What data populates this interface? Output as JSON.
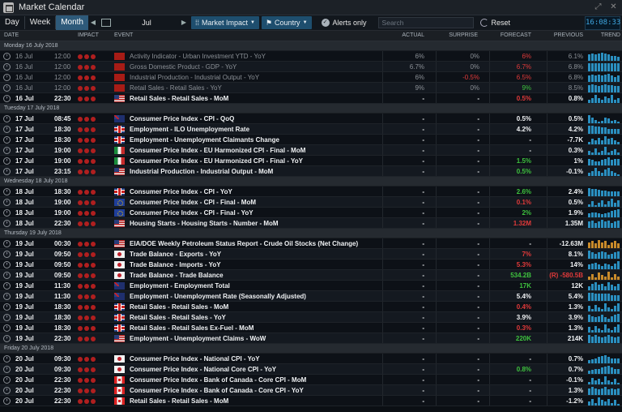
{
  "window": {
    "title": "Market Calendar"
  },
  "toolbar": {
    "day": "Day",
    "week": "Week",
    "month": "Month",
    "month_value": "Jul",
    "market_impact": "Market Impact",
    "country": "Country",
    "alerts_only": "Alerts only",
    "search_placeholder": "Search",
    "reset": "Reset",
    "clock": "16:08:33"
  },
  "columns": {
    "date": "DATE",
    "impact": "IMPACT",
    "event": "EVENT",
    "actual": "ACTUAL",
    "surprise": "SURPRISE",
    "forecast": "FORECAST",
    "previous": "PREVIOUS",
    "trend": "TREND"
  },
  "colors": {
    "accent": "#2e5a7a",
    "impact_dot": "#b01f1f",
    "negative": "#e23a3a",
    "positive": "#3ec23e",
    "trend_bar": "#2a8fc0",
    "trend_bar_alt": "#c88a2a"
  },
  "days": [
    {
      "label": "Monday 16 July 2018",
      "rows": [
        {
          "date": "16 Jul",
          "time": "12:00",
          "flag": "cn",
          "event": "Activity Indicator - Urban Investment YTD - YoY",
          "actual": "6%",
          "surprise": "0%",
          "forecast": "6%",
          "forecast_color": "red",
          "previous": "6.1%",
          "state": "past",
          "trend": [
            6,
            7,
            6,
            7,
            8,
            7,
            6,
            5,
            5,
            4
          ],
          "trend_color": "blue"
        },
        {
          "date": "16 Jul",
          "time": "12:00",
          "flag": "cn",
          "event": "Gross Domestic Product - GDP - YoY",
          "actual": "6.7%",
          "surprise": "0%",
          "forecast": "6.7%",
          "forecast_color": "red",
          "previous": "6.8%",
          "state": "past",
          "trend": [
            7,
            7,
            7,
            7,
            7,
            7,
            7,
            7,
            7,
            7
          ],
          "trend_color": "blue"
        },
        {
          "date": "16 Jul",
          "time": "12:00",
          "flag": "cn",
          "event": "Industrial Production - Industrial Output - YoY",
          "actual": "6%",
          "surprise": "-0.5%",
          "surprise_color": "red",
          "forecast": "6.5%",
          "forecast_color": "red",
          "previous": "6.8%",
          "state": "past",
          "trend": [
            6,
            7,
            6,
            7,
            6,
            7,
            8,
            6,
            5,
            6
          ],
          "trend_color": "blue"
        },
        {
          "date": "16 Jul",
          "time": "12:00",
          "flag": "cn",
          "event": "Retail Sales - Retail Sales - YoY",
          "actual": "9%",
          "surprise": "0%",
          "forecast": "9%",
          "forecast_color": "green",
          "previous": "8.5%",
          "state": "past",
          "trend": [
            9,
            10,
            9,
            8,
            9,
            10,
            9,
            9,
            8,
            8
          ],
          "trend_color": "blue"
        },
        {
          "date": "16 Jul",
          "time": "22:30",
          "flag": "us",
          "event": "Retail Sales - Retail Sales - MoM",
          "actual": "-",
          "surprise": "-",
          "forecast": "0.5%",
          "forecast_color": "red",
          "previous": "0.8%",
          "state": "cur",
          "trend": [
            2,
            3,
            5,
            3,
            2,
            4,
            3,
            5,
            2,
            3
          ],
          "trend_color": "blue"
        }
      ]
    },
    {
      "label": "Tuesday 17 July 2018",
      "rows": [
        {
          "date": "17 Jul",
          "time": "08:45",
          "flag": "au",
          "event": "Consumer Price Index - CPI - QoQ",
          "actual": "-",
          "surprise": "-",
          "forecast": "0.5%",
          "forecast_color": "white",
          "previous": "0.5%",
          "state": "cur",
          "trend": [
            9,
            6,
            4,
            2,
            3,
            6,
            5,
            3,
            4,
            2
          ],
          "trend_color": "blue"
        },
        {
          "date": "17 Jul",
          "time": "18:30",
          "flag": "gb",
          "event": "Employment - ILO Unemployment Rate",
          "actual": "-",
          "surprise": "-",
          "forecast": "4.2%",
          "forecast_color": "white",
          "previous": "4.2%",
          "state": "cur",
          "trend": [
            8,
            8,
            7,
            7,
            6,
            6,
            5,
            5,
            5,
            5
          ],
          "trend_color": "blue"
        },
        {
          "date": "17 Jul",
          "time": "18:30",
          "flag": "gb",
          "event": "Employment - Unemployment Claimants Change",
          "actual": "-",
          "surprise": "-",
          "forecast": "-",
          "forecast_color": "white",
          "previous": "-7.7K",
          "state": "cur",
          "trend": [
            2,
            4,
            3,
            5,
            3,
            6,
            4,
            5,
            3,
            2
          ],
          "trend_color": "blue"
        },
        {
          "date": "17 Jul",
          "time": "19:00",
          "flag": "it",
          "event": "Consumer Price Index - EU Harmonized CPI - Final - MoM",
          "actual": "-",
          "surprise": "-",
          "forecast": "-",
          "forecast_color": "white",
          "previous": "0.3%",
          "state": "cur",
          "trend": [
            3,
            2,
            5,
            2,
            3,
            6,
            2,
            3,
            4,
            2
          ],
          "trend_color": "blue"
        },
        {
          "date": "17 Jul",
          "time": "19:00",
          "flag": "it",
          "event": "Consumer Price Index - EU Harmonized CPI - Final - YoY",
          "actual": "-",
          "surprise": "-",
          "forecast": "1.5%",
          "forecast_color": "green",
          "previous": "1%",
          "state": "cur",
          "trend": [
            5,
            4,
            3,
            3,
            4,
            5,
            6,
            4,
            5,
            5
          ],
          "trend_color": "blue"
        },
        {
          "date": "17 Jul",
          "time": "23:15",
          "flag": "us",
          "event": "Industrial Production - Industrial Output - MoM",
          "actual": "-",
          "surprise": "-",
          "forecast": "0.5%",
          "forecast_color": "green",
          "previous": "-0.1%",
          "state": "cur",
          "trend": [
            2,
            3,
            5,
            3,
            2,
            4,
            5,
            3,
            2,
            1
          ],
          "trend_color": "blue"
        }
      ]
    },
    {
      "label": "Wednesday 18 July 2018",
      "rows": [
        {
          "date": "18 Jul",
          "time": "18:30",
          "flag": "gb",
          "event": "Consumer Price Index - CPI - YoY",
          "actual": "-",
          "surprise": "-",
          "forecast": "2.6%",
          "forecast_color": "green",
          "previous": "2.4%",
          "state": "cur",
          "trend": [
            9,
            8,
            8,
            7,
            6,
            6,
            5,
            5,
            5,
            5
          ],
          "trend_color": "blue"
        },
        {
          "date": "18 Jul",
          "time": "19:00",
          "flag": "eu",
          "event": "Consumer Price Index - CPI - Final - MoM",
          "actual": "-",
          "surprise": "-",
          "forecast": "0.1%",
          "forecast_color": "red",
          "previous": "0.5%",
          "state": "cur",
          "trend": [
            2,
            4,
            1,
            3,
            5,
            2,
            4,
            6,
            3,
            5
          ],
          "trend_color": "blue"
        },
        {
          "date": "18 Jul",
          "time": "19:00",
          "flag": "eu",
          "event": "Consumer Price Index - CPI - Final - YoY",
          "actual": "-",
          "surprise": "-",
          "forecast": "2%",
          "forecast_color": "green",
          "previous": "1.9%",
          "state": "cur",
          "trend": [
            4,
            5,
            5,
            4,
            3,
            4,
            5,
            6,
            7,
            8
          ],
          "trend_color": "blue"
        },
        {
          "date": "18 Jul",
          "time": "22:30",
          "flag": "us",
          "event": "Housing Starts - Housing Starts - Number - MoM",
          "actual": "-",
          "surprise": "-",
          "forecast": "1.32M",
          "forecast_color": "red",
          "previous": "1.35M",
          "state": "cur",
          "trend": [
            6,
            7,
            5,
            6,
            8,
            6,
            7,
            5,
            6,
            7
          ],
          "trend_color": "blue"
        }
      ]
    },
    {
      "label": "Thursday 19 July 2018",
      "rows": [
        {
          "date": "19 Jul",
          "time": "00:30",
          "flag": "us",
          "event": "EIA/DOE Weekly Petroleum Status Report - Crude Oil Stocks (Net Change)",
          "actual": "-",
          "surprise": "-",
          "forecast": "-",
          "forecast_color": "white",
          "previous": "-12.63M",
          "state": "cur",
          "trend": [
            5,
            6,
            4,
            7,
            5,
            6,
            3,
            5,
            6,
            4
          ],
          "trend_color": "orange"
        },
        {
          "date": "19 Jul",
          "time": "09:50",
          "flag": "jp",
          "event": "Trade Balance - Exports - YoY",
          "actual": "-",
          "surprise": "-",
          "forecast": "7%",
          "forecast_color": "red",
          "previous": "8.1%",
          "state": "cur",
          "trend": [
            8,
            6,
            5,
            6,
            7,
            6,
            4,
            5,
            6,
            7
          ],
          "trend_color": "blue"
        },
        {
          "date": "19 Jul",
          "time": "09:50",
          "flag": "jp",
          "event": "Trade Balance - Imports - YoY",
          "actual": "-",
          "surprise": "-",
          "forecast": "5.3%",
          "forecast_color": "red",
          "previous": "14%",
          "state": "cur",
          "trend": [
            5,
            6,
            7,
            5,
            4,
            6,
            5,
            4,
            6,
            9
          ],
          "trend_color": "blue"
        },
        {
          "date": "19 Jul",
          "time": "09:50",
          "flag": "jp",
          "event": "Trade Balance - Trade Balance",
          "actual": "-",
          "surprise": "-",
          "forecast": "534.2B",
          "forecast_color": "green",
          "previous": "(R) -580.5B",
          "previous_color": "red",
          "state": "cur",
          "trend": [
            3,
            5,
            2,
            6,
            4,
            3,
            7,
            2,
            5,
            3
          ],
          "trend_color": "orange"
        },
        {
          "date": "19 Jul",
          "time": "11:30",
          "flag": "au",
          "event": "Employment - Employment Total",
          "actual": "-",
          "surprise": "-",
          "forecast": "17K",
          "forecast_color": "green",
          "previous": "12K",
          "state": "cur",
          "trend": [
            3,
            5,
            6,
            4,
            5,
            3,
            6,
            4,
            3,
            5
          ],
          "trend_color": "blue"
        },
        {
          "date": "19 Jul",
          "time": "11:30",
          "flag": "au",
          "event": "Employment - Unemployment Rate (Seasonally Adjusted)",
          "actual": "-",
          "surprise": "-",
          "forecast": "5.4%",
          "forecast_color": "white",
          "previous": "5.4%",
          "state": "cur",
          "trend": [
            7,
            7,
            6,
            6,
            6,
            6,
            6,
            5,
            5,
            5
          ],
          "trend_color": "blue"
        },
        {
          "date": "19 Jul",
          "time": "18:30",
          "flag": "gb",
          "event": "Retail Sales - Retail Sales - MoM",
          "actual": "-",
          "surprise": "-",
          "forecast": "0.4%",
          "forecast_color": "red",
          "previous": "1.3%",
          "state": "cur",
          "trend": [
            4,
            2,
            5,
            3,
            2,
            6,
            3,
            2,
            4,
            6
          ],
          "trend_color": "blue"
        },
        {
          "date": "19 Jul",
          "time": "18:30",
          "flag": "gb",
          "event": "Retail Sales - Retail Sales - YoY",
          "actual": "-",
          "surprise": "-",
          "forecast": "3.9%",
          "forecast_color": "white",
          "previous": "3.9%",
          "state": "cur",
          "trend": [
            6,
            5,
            4,
            5,
            6,
            4,
            3,
            5,
            6,
            7
          ],
          "trend_color": "blue"
        },
        {
          "date": "19 Jul",
          "time": "18:30",
          "flag": "gb",
          "event": "Retail Sales - Retail Sales Ex-Fuel - MoM",
          "actual": "-",
          "surprise": "-",
          "forecast": "0.3%",
          "forecast_color": "red",
          "previous": "1.3%",
          "state": "cur",
          "trend": [
            4,
            2,
            5,
            3,
            2,
            6,
            3,
            2,
            4,
            6
          ],
          "trend_color": "blue"
        },
        {
          "date": "19 Jul",
          "time": "22:30",
          "flag": "us",
          "event": "Employment - Unemployment Claims - WoW",
          "actual": "-",
          "surprise": "-",
          "forecast": "220K",
          "forecast_color": "green",
          "previous": "214K",
          "state": "cur",
          "trend": [
            6,
            5,
            6,
            5,
            4,
            5,
            6,
            5,
            4,
            5
          ],
          "trend_color": "blue"
        }
      ]
    },
    {
      "label": "Friday 20 July 2018",
      "rows": [
        {
          "date": "20 Jul",
          "time": "09:30",
          "flag": "jp",
          "event": "Consumer Price Index - National CPI - YoY",
          "actual": "-",
          "surprise": "-",
          "forecast": "-",
          "forecast_color": "white",
          "previous": "0.7%",
          "state": "cur",
          "trend": [
            3,
            4,
            5,
            6,
            7,
            8,
            6,
            5,
            5,
            5
          ],
          "trend_color": "blue"
        },
        {
          "date": "20 Jul",
          "time": "09:30",
          "flag": "jp",
          "event": "Consumer Price Index - National Core CPI - YoY",
          "actual": "-",
          "surprise": "-",
          "forecast": "0.8%",
          "forecast_color": "green",
          "previous": "0.7%",
          "state": "cur",
          "trend": [
            3,
            4,
            5,
            5,
            6,
            7,
            8,
            6,
            5,
            5
          ],
          "trend_color": "blue"
        },
        {
          "date": "20 Jul",
          "time": "22:30",
          "flag": "ca",
          "event": "Consumer Price Index - Bank of Canada - Core CPI - MoM",
          "actual": "-",
          "surprise": "-",
          "forecast": "-",
          "forecast_color": "white",
          "previous": "-0.1%",
          "state": "cur",
          "trend": [
            2,
            5,
            3,
            4,
            2,
            6,
            3,
            2,
            4,
            1
          ],
          "trend_color": "blue"
        },
        {
          "date": "20 Jul",
          "time": "22:30",
          "flag": "ca",
          "event": "Consumer Price Index - Bank of Canada - Core CPI - YoY",
          "actual": "-",
          "surprise": "-",
          "forecast": "-",
          "forecast_color": "white",
          "previous": "1.3%",
          "state": "cur",
          "trend": [
            5,
            6,
            5,
            4,
            5,
            6,
            4,
            5,
            4,
            5
          ],
          "trend_color": "blue"
        },
        {
          "date": "20 Jul",
          "time": "22:30",
          "flag": "ca",
          "event": "Retail Sales - Retail Sales - MoM",
          "actual": "-",
          "surprise": "-",
          "forecast": "-",
          "forecast_color": "white",
          "previous": "-1.2%",
          "state": "cur",
          "trend": [
            3,
            5,
            2,
            6,
            4,
            3,
            5,
            2,
            4,
            1
          ],
          "trend_color": "blue"
        }
      ]
    }
  ]
}
